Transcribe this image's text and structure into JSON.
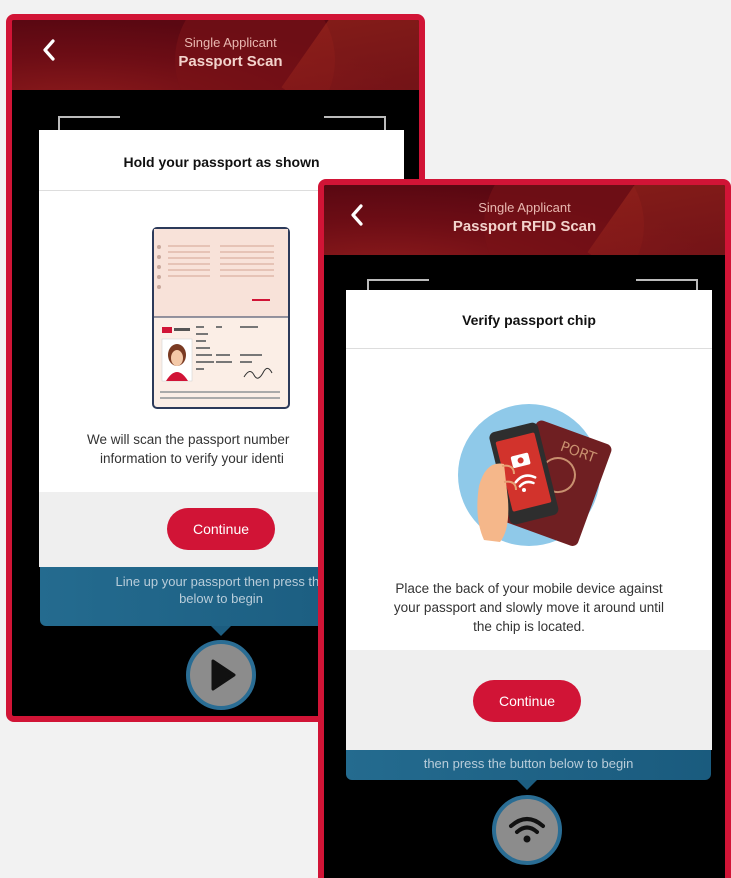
{
  "screen1": {
    "back_icon": "chevron-left-icon",
    "header_subtitle": "Single Applicant",
    "header_title": "Passport Scan",
    "modal_title": "Hold your passport as shown",
    "illustration": "passport-data-page",
    "body_text_line1": "We will scan the passport number",
    "body_text_line2": "information to verify your identi",
    "continue_label": "Continue",
    "banner_line1": "Line up your passport then press the",
    "banner_line2": "below to begin",
    "action_icon": "play-icon"
  },
  "screen2": {
    "back_icon": "chevron-left-icon",
    "header_subtitle": "Single Applicant",
    "header_title": "Passport RFID Scan",
    "modal_title": "Verify passport chip",
    "illustration": "phone-over-passport",
    "body_text_line1": "Place the back of your mobile device against",
    "body_text_line2": "your passport and slowly move it around until",
    "body_text_line3": "the chip is located.",
    "continue_label": "Continue",
    "banner_line": "then press the button below to begin",
    "action_icon": "wifi-icon"
  },
  "colors": {
    "brand_red": "#d11436",
    "header_dark": "#6d0d15",
    "banner_blue": "#246b8f"
  }
}
